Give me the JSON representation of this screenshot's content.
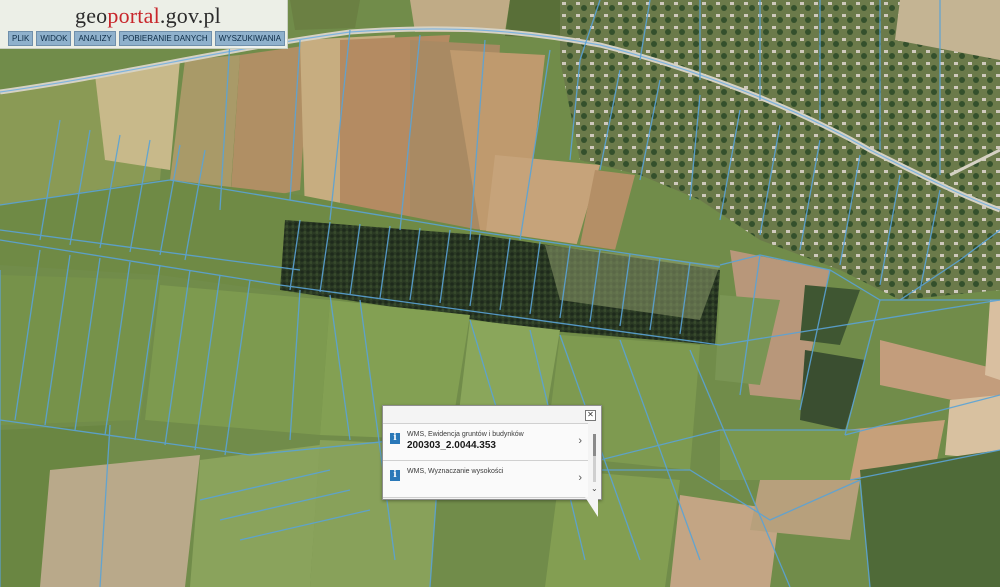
{
  "header": {
    "logo": {
      "geo": "geo",
      "portal": "portal",
      "gov": ".gov.pl"
    },
    "menu": [
      "PLIK",
      "WIDOK",
      "ANALIZY",
      "POBIERANIE DANYCH",
      "WYSZUKIWANIA"
    ]
  },
  "popup": {
    "close_icon": "close-icon",
    "items": [
      {
        "layer": "WMS, Ewidencja gruntów i budynków",
        "parcel": "200303_2.0044.353",
        "icon": "info-icon"
      },
      {
        "layer": "WMS, Wyznaczanie wysokości",
        "parcel": "",
        "icon": "info-icon"
      }
    ]
  },
  "colors": {
    "parcel_lines": "#5aa3d6",
    "menu_bg": "#8fb1cc",
    "logo_red": "#c8262b"
  }
}
